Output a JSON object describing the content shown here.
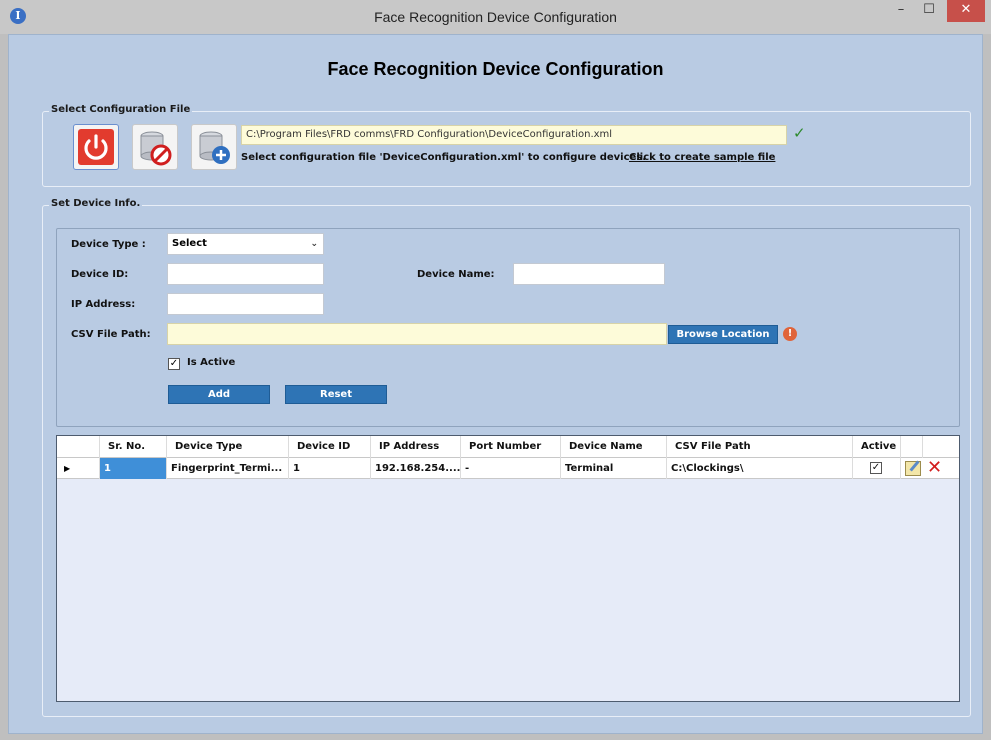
{
  "window": {
    "title": "Face Recognition Device Configuration",
    "app_icon_glyph": "I",
    "minimize_glyph": "–",
    "maximize_glyph": "☐",
    "close_glyph": "✕"
  },
  "heading": "Face Recognition Device Configuration",
  "config_file": {
    "legend": "Select Configuration File",
    "path": "C:\\Program Files\\FRD comms\\FRD Configuration\\DeviceConfiguration.xml",
    "hint": "Select configuration file 'DeviceConfiguration.xml' to configure devices.",
    "sample_link": "Click to create sample file",
    "status_icon": "check-icon"
  },
  "device_info": {
    "legend": "Set Device Info.",
    "device_type_label": "Device Type :",
    "device_type_value": "Select",
    "device_id_label": "Device ID:",
    "device_id_value": "",
    "device_name_label": "Device Name:",
    "device_name_value": "",
    "ip_label": "IP Address:",
    "ip_value": "",
    "csv_label": "CSV File Path:",
    "csv_value": "",
    "browse_label": "Browse Location",
    "is_active_label": "Is Active",
    "is_active_checked": true,
    "add_label": "Add",
    "reset_label": "Reset"
  },
  "grid": {
    "columns": [
      "Sr. No.",
      "Device Type",
      "Device ID",
      "IP Address",
      "Port Number",
      "Device Name",
      "CSV File Path",
      "Active"
    ],
    "rows": [
      {
        "sr_no": "1",
        "device_type": "Fingerprint_Termi...",
        "device_id": "1",
        "ip_address": "192.168.254....",
        "port_number": "-",
        "device_name": "Terminal",
        "csv_file_path": "C:\\Clockings\\",
        "active": true
      }
    ]
  },
  "colors": {
    "client_bg": "#b9cbe3",
    "accent_button": "#2e74b5",
    "close_button": "#c7504a",
    "selected_cell": "#3f8fd8"
  }
}
